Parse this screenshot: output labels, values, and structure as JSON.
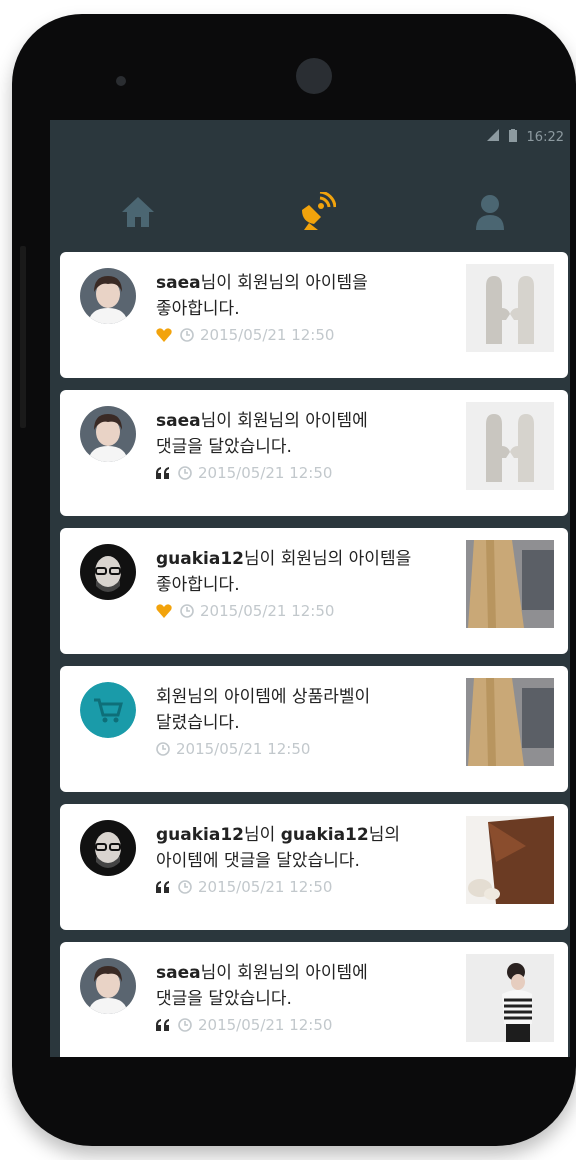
{
  "status": {
    "time": "16:22"
  },
  "tabs": [
    {
      "icon": "home-icon",
      "active": false
    },
    {
      "icon": "satellite-dish-icon",
      "active": true
    },
    {
      "icon": "user-icon",
      "active": false
    }
  ],
  "colors": {
    "accent": "#f2a30c",
    "screen_bg": "#2b373d",
    "teal": "#1a9ba9",
    "meta_text": "#c2c8cc"
  },
  "notifications": [
    {
      "user": "saea",
      "text1": "님이 회원님의 아이템을",
      "line2": "좋아합니다.",
      "icon": "heart-icon",
      "timestamp": "2015/05/21 12:50",
      "avatar": "saea",
      "thumb": "mittens"
    },
    {
      "user": "saea",
      "text1": "님이 회원님의 아이템에",
      "line2": "댓글을 달았습니다.",
      "icon": "quote-icon",
      "timestamp": "2015/05/21 12:50",
      "avatar": "saea",
      "thumb": "mittens"
    },
    {
      "user": "guakia12",
      "text1": "님이 회원님의 아이템을",
      "line2": "좋아합니다.",
      "icon": "heart-icon",
      "timestamp": "2015/05/21 12:50",
      "avatar": "guakia",
      "thumb": "coat"
    },
    {
      "user": "",
      "text1": "회원님의 아이템에 상품라벨이",
      "line2": "달렸습니다.",
      "icon": "",
      "timestamp": "2015/05/21 12:50",
      "avatar": "cart",
      "thumb": "coat"
    },
    {
      "user": "guakia12",
      "text1": "님이 ",
      "user2": "guakia12",
      "text1b": "님의",
      "line2": "아이템에 댓글을 달았습니다.",
      "icon": "quote-icon",
      "timestamp": "2015/05/21 12:50",
      "avatar": "guakia",
      "thumb": "clutch"
    },
    {
      "user": "saea",
      "text1": "님이 회원님의 아이템에",
      "line2": "댓글을 달았습니다.",
      "icon": "quote-icon",
      "timestamp": "2015/05/21 12:50",
      "avatar": "saea",
      "thumb": "woman"
    }
  ]
}
